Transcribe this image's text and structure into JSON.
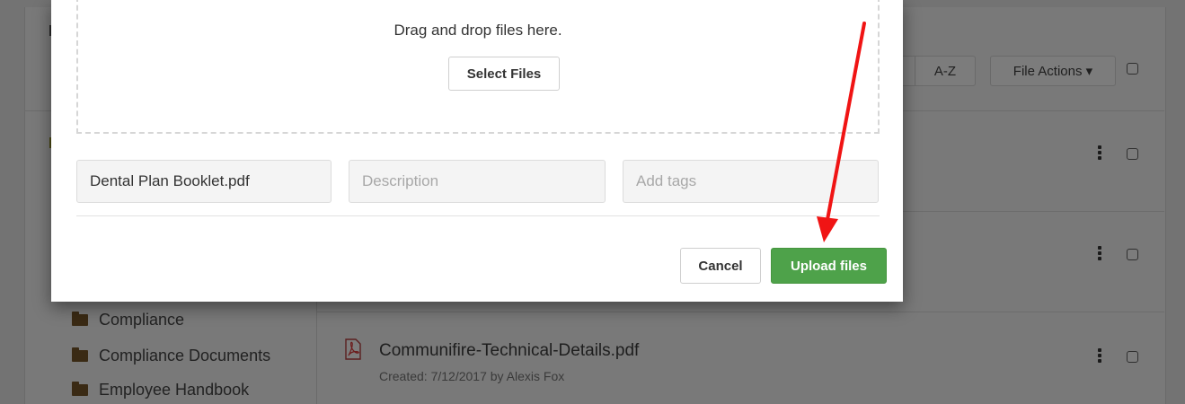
{
  "toolbar": {
    "sort_label": "A-Z",
    "file_actions_label": "File Actions ▾"
  },
  "sidebar": {
    "folders": [
      {
        "label": "Compliance"
      },
      {
        "label": "Compliance Documents"
      },
      {
        "label": "Employee Handbook"
      }
    ]
  },
  "files": [
    {
      "title": "Communifire-Technical-Details.pdf",
      "meta": "Created: 7/12/2017 by Alexis Fox",
      "icon": "pdf-icon"
    }
  ],
  "upload_modal": {
    "drop_text": "Drag and drop files here.",
    "select_files_label": "Select Files",
    "filename_value": "Dental Plan Booklet.pdf",
    "description_placeholder": "Description",
    "tags_placeholder": "Add tags",
    "cancel_label": "Cancel",
    "upload_label": "Upload files"
  },
  "colors": {
    "upload_button": "#4ea24a",
    "annotation_arrow": "#f01414",
    "overlay": "#737373"
  }
}
